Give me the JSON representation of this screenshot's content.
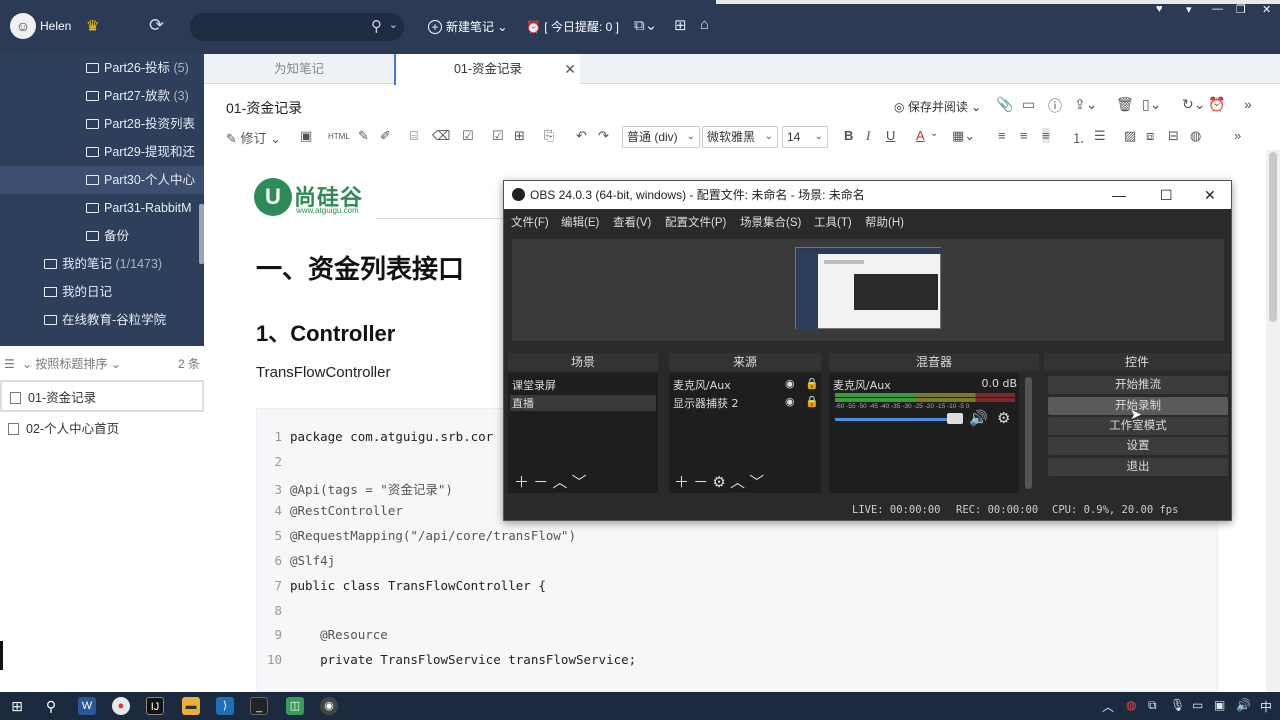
{
  "app": {
    "user": "Helen",
    "new_note": "新建笔记",
    "reminder": "[ 今日提醒: 0 ]"
  },
  "tree": {
    "items": [
      {
        "label": "Part26-投标",
        "count": "(5)"
      },
      {
        "label": "Part27-放款",
        "count": "(3)"
      },
      {
        "label": "Part28-投资列表",
        "count": ""
      },
      {
        "label": "Part29-提现和还",
        "count": ""
      },
      {
        "label": "Part30-个人中心",
        "count": ""
      },
      {
        "label": "Part31-RabbitM",
        "count": ""
      },
      {
        "label": "备份",
        "count": ""
      },
      {
        "label": "我的笔记",
        "count": "(1/1473)"
      },
      {
        "label": "我的日记",
        "count": ""
      },
      {
        "label": "在线教育-谷粒学院",
        "count": ""
      }
    ]
  },
  "sortbar": {
    "label": "按照标题排序",
    "count": "2 条"
  },
  "notes": [
    {
      "title": "01-资金记录"
    },
    {
      "title": "02-个人中心首页"
    }
  ],
  "tabs": [
    {
      "label": "为知笔记"
    },
    {
      "label": "01-资金记录"
    }
  ],
  "note": {
    "title": "01-资金记录",
    "read_mode": "保存并阅读",
    "revise": "修订"
  },
  "editor": {
    "format": "普通 (div)",
    "font": "微软雅黑",
    "size": "14"
  },
  "doc": {
    "logo_brand": "尚硅谷",
    "logo_url": "www.atguigu.com",
    "h1": "一、资金列表接口",
    "h2": "1、Controller",
    "para": "TransFlowController",
    "code": [
      {
        "n": "1",
        "text": "package com.atguigu.srb.cor"
      },
      {
        "n": "2",
        "text": ""
      },
      {
        "n": "3",
        "text": "@Api(tags = \"资金记录\")"
      },
      {
        "n": "4",
        "text": "@RestController"
      },
      {
        "n": "5",
        "text": "@RequestMapping(\"/api/core/transFlow\")"
      },
      {
        "n": "6",
        "text": "@Slf4j"
      },
      {
        "n": "7",
        "text": "public class TransFlowController {"
      },
      {
        "n": "8",
        "text": ""
      },
      {
        "n": "9",
        "text": "    @Resource"
      },
      {
        "n": "10",
        "text": "    private TransFlowService transFlowService;"
      }
    ]
  },
  "obs": {
    "title": "OBS 24.0.3 (64-bit, windows) - 配置文件: 未命名 - 场景: 未命名",
    "menu": [
      "文件(F)",
      "编辑(E)",
      "查看(V)",
      "配置文件(P)",
      "场景集合(S)",
      "工具(T)",
      "帮助(H)"
    ],
    "docks": {
      "scenes": "场景",
      "sources": "来源",
      "mixer": "混音器",
      "controls": "控件"
    },
    "scenes": [
      "课堂录屏",
      "直播"
    ],
    "sources": [
      "麦克风/Aux",
      "显示器捕获 2"
    ],
    "mixer": {
      "name": "麦克风/Aux",
      "db": "0.0 dB",
      "ticks": "-60 -55 -50 -45 -40 -35 -30 -25 -20 -15 -10 -5 0"
    },
    "controls": [
      "开始推流",
      "开始录制",
      "工作室模式",
      "设置",
      "退出"
    ],
    "status": {
      "live": "LIVE: 00:00:00",
      "rec": "REC: 00:00:00",
      "cpu": "CPU: 0.9%, 20.00 fps"
    }
  },
  "taskbar": {
    "lang": "中",
    "icons": [
      "start-icon",
      "search-icon",
      "word-icon",
      "chrome-icon",
      "idea-icon",
      "folder-icon",
      "vscode-icon",
      "terminal-icon",
      "wiznote-icon",
      "obs-icon"
    ]
  }
}
